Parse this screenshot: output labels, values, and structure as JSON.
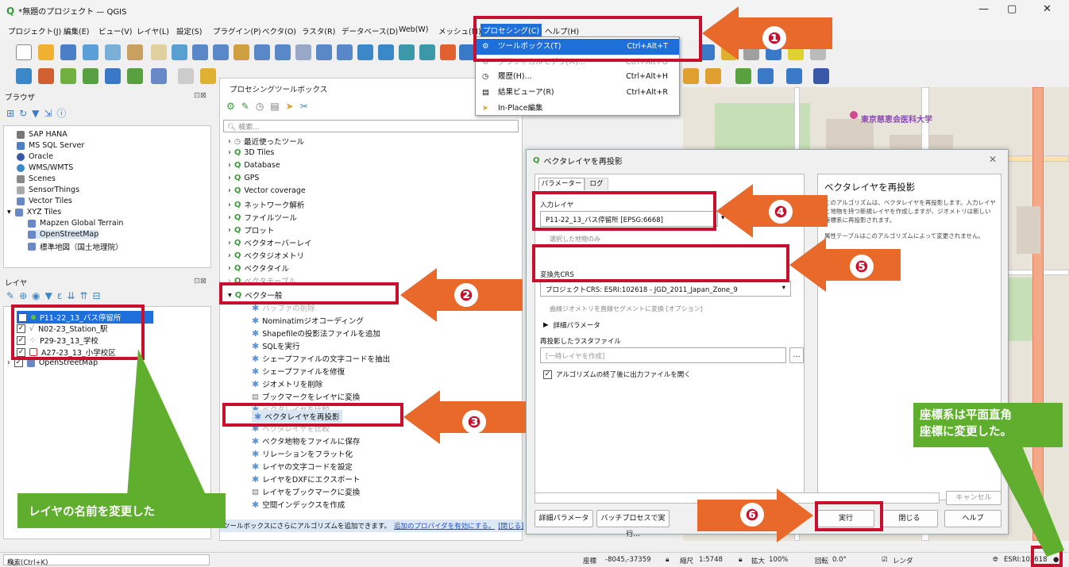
{
  "window": {
    "title": "*無題のプロジェクト — QGIS",
    "min": "—",
    "max": "▢",
    "close": "✕"
  },
  "menubar": [
    "プロジェクト(J)",
    "編集(E)",
    "ビュー(V)",
    "レイヤ(L)",
    "設定(S)",
    "プラグイン(P)",
    "ベクタ(O)",
    "ラスタ(R)",
    "データベース(D)",
    "Web(W)",
    "メッシュ(M)",
    "プロセシング(C)",
    "ヘルプ(H)"
  ],
  "processing_menu": {
    "items": [
      {
        "label": "ツールボックス(T)",
        "shortcut": "Ctrl+Alt+T"
      },
      {
        "label": "グラフィカルモデラ(M)...",
        "shortcut": "Ctrl+Alt+G"
      },
      {
        "label": "履歴(H)...",
        "shortcut": "Ctrl+Alt+H"
      },
      {
        "label": "結果ビューア(R)",
        "shortcut": "Ctrl+Alt+R"
      },
      {
        "label": "In-Place編集",
        "shortcut": ""
      }
    ]
  },
  "browser": {
    "title": "ブラウザ",
    "items": [
      "SAP HANA",
      "MS SQL Server",
      "Oracle",
      "WMS/WMTS",
      "Scenes",
      "SensorThings",
      "Vector Tiles",
      "XYZ Tiles",
      "Mapzen Global Terrain",
      "OpenStreetMap",
      "標準地図（国土地理院）"
    ]
  },
  "layers": {
    "title": "レイヤ",
    "items": [
      "P11-22_13_バス停留所",
      "N02-23_Station_駅",
      "P29-23_13_学校",
      "A27-23_13_小学校区",
      "OpenStreetMap"
    ]
  },
  "toolbox": {
    "title": "プロセシングツールボックス",
    "search_placeholder": "検索...",
    "groups": [
      "最近使ったツール",
      "3D Tiles",
      "Database",
      "GPS",
      "Vector coverage",
      "ネットワーク解析",
      "ファイルツール",
      "プロット",
      "ベクタオーバーレイ",
      "ベクタジオメトリ",
      "ベクタタイル",
      "ベクタテーブル",
      "ベクタ一般"
    ],
    "tools": [
      "バッファの削除",
      "Nominatimジオコーディング",
      "Shapefileの投影法ファイルを追加",
      "SQLを実行",
      "シェープファイルの文字コードを抽出",
      "シェープファイルを修復",
      "ジオメトリを削除",
      "ブックマークをレイヤに変換",
      "ベクタレイヤを比較",
      "ベクタレイヤを再投影",
      "ベクタレイヤを比較",
      "ベクタ地物をファイルに保存",
      "リレーションをフラット化",
      "レイヤの文字コードを設定",
      "レイヤをDXFにエクスポート",
      "レイヤをブックマークに変換",
      "空間インデックスを作成"
    ],
    "footer": "ツールボックスにさらにアルゴリズムを追加できます。",
    "footer_link": "追加のプロバイダを有効にする。",
    "footer_link2": "[閉じる]"
  },
  "dialog": {
    "title": "ベクタレイヤを再投影",
    "tab_params": "パラメーター",
    "tab_log": "ログ",
    "input_label": "入力レイヤ",
    "input_value": "P11-22_13_バス停留所 [EPSG:6668]",
    "selected_only": "選択した地物のみ",
    "target_crs_label": "変換先CRS",
    "target_crs_value": "プロジェクトCRS: ESRI:102618 - JGD_2011_Japan_Zone_9",
    "curve_convert": "曲線ジオメトリを直線セグメントに変換 [オプション]",
    "advanced": "詳細パラメータ",
    "output_label": "再投影したラスタファイル",
    "output_placeholder": "[一時レイヤを作成]",
    "open_after": "アルゴリズムの終了後に出力ファイルを開く",
    "help_title": "ベクタレイヤを再投影",
    "help_text": "このアルゴリズムは、ベクタレイヤを再投影します。入力レイヤと地物を持つ新規レイヤを作成しますが、ジオメトリは新しい座標系に再投影されます。",
    "help_text2": "属性テーブルはこのアルゴリズムによって変更されません。",
    "cancel": "キャンセル",
    "advanced_btn": "詳細パラメータ",
    "batch_btn": "バッチプロセスで実行...",
    "run": "実行",
    "close": "閉じる",
    "help": "ヘルプ"
  },
  "map": {
    "label": "東京慈恵会医科大学"
  },
  "status": {
    "search_placeholder": "検索(Ctrl+K)",
    "coord_label": "座標",
    "coord_value": "-8045,-37359",
    "scale_label": "縮尺",
    "scale_value": "1:5748",
    "zoom_label": "拡大",
    "zoom_value": "100%",
    "rotation_label": "回転",
    "rotation_value": "0.0°",
    "render_label": "レンダ",
    "crs_value": "ESRI:102618"
  },
  "annotations": {
    "nums": [
      "❶",
      "❷",
      "❸",
      "❹",
      "❺",
      "❻"
    ],
    "layer_note": "レイヤの名前を変更した",
    "crs_note_1": "座標系は平面直角",
    "crs_note_2": "座標に変更した。"
  },
  "colors": {
    "red": "#c8102e",
    "orange": "#e8692a",
    "green": "#5fae2e",
    "highlight": "#1e6fd9"
  }
}
